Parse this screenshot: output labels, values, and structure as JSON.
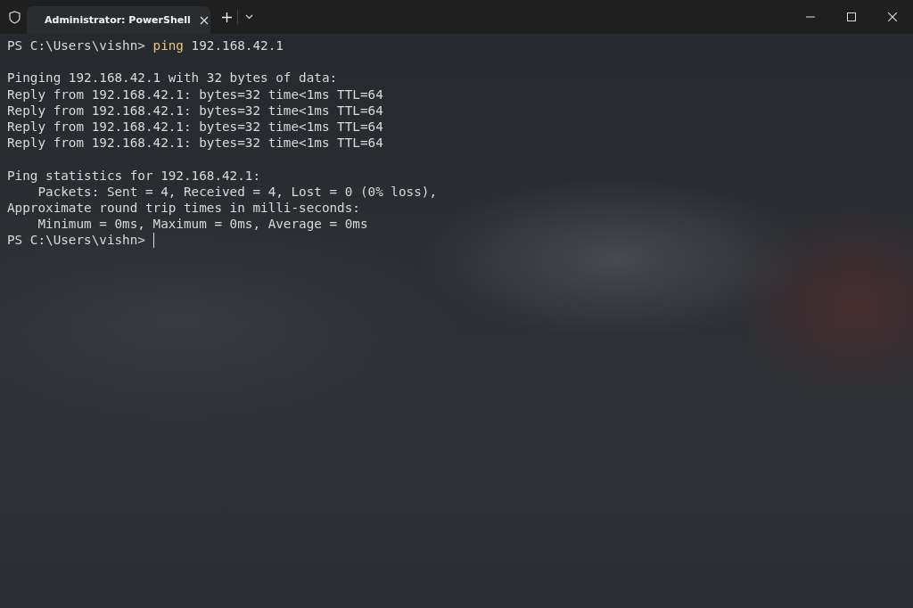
{
  "tabs": [
    {
      "label": "Administrator: PowerShell",
      "selected": true
    }
  ],
  "terminal": {
    "lines": [
      {
        "kind": "prompt",
        "prompt": "PS C:\\Users\\vishn>",
        "command": "ping",
        "args": "192.168.42.1"
      },
      {
        "kind": "blank"
      },
      {
        "kind": "output",
        "text": "Pinging 192.168.42.1 with 32 bytes of data:"
      },
      {
        "kind": "output",
        "text": "Reply from 192.168.42.1: bytes=32 time<1ms TTL=64"
      },
      {
        "kind": "output",
        "text": "Reply from 192.168.42.1: bytes=32 time<1ms TTL=64"
      },
      {
        "kind": "output",
        "text": "Reply from 192.168.42.1: bytes=32 time<1ms TTL=64"
      },
      {
        "kind": "output",
        "text": "Reply from 192.168.42.1: bytes=32 time<1ms TTL=64"
      },
      {
        "kind": "blank"
      },
      {
        "kind": "output",
        "text": "Ping statistics for 192.168.42.1:"
      },
      {
        "kind": "output",
        "text": "    Packets: Sent = 4, Received = 4, Lost = 0 (0% loss),"
      },
      {
        "kind": "output",
        "text": "Approximate round trip times in milli-seconds:"
      },
      {
        "kind": "output",
        "text": "    Minimum = 0ms, Maximum = 0ms, Average = 0ms"
      },
      {
        "kind": "prompt",
        "prompt": "PS C:\\Users\\vishn>",
        "cursor": true
      }
    ]
  }
}
